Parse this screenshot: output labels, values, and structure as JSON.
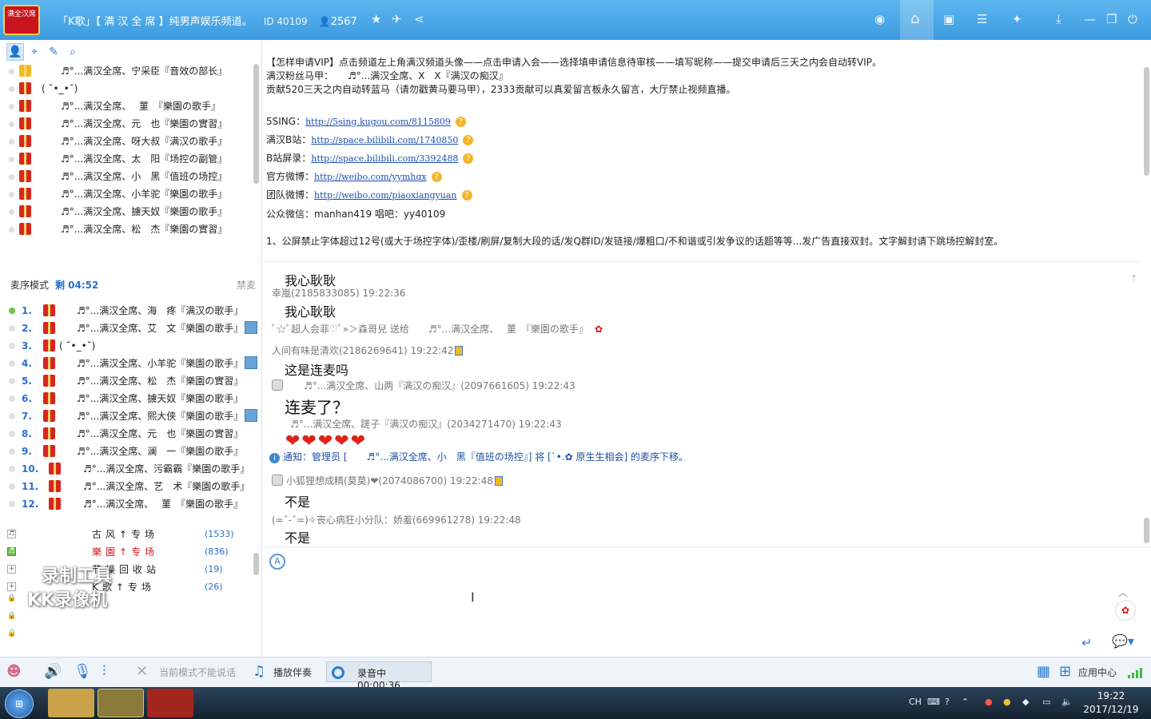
{
  "titlebar": {
    "logo_text": "满全汉席",
    "title": "「K歌」【 满 汉 全 席 】纯男声娱乐频道。",
    "id_label": "ID 40109",
    "online_count": "2567"
  },
  "members": [
    {
      "gift": "gold",
      "name": "♬°...满汉全席、宁采臣『音效の部长』"
    },
    {
      "gift": "red",
      "name": "( ˘•_•˘)",
      "short": true
    },
    {
      "gift": "red",
      "name": "♬°...满汉全席、　 菫　『樂園の歌手』"
    },
    {
      "gift": "red",
      "name": "♬°...满汉全席、元　也『樂園の實習』"
    },
    {
      "gift": "red",
      "name": "♬°...满汉全席、呀大叔『满汉の歌手』"
    },
    {
      "gift": "red",
      "name": "♬°...满汉全席、太　阳『场控の副管』"
    },
    {
      "gift": "red",
      "name": "♬°...满汉全席、小　黑『值班の场控』"
    },
    {
      "gift": "red",
      "name": "♬°...满汉全席、小羊驼『樂園の歌手』"
    },
    {
      "gift": "red",
      "name": "♬°...满汉全席、擄天奴『樂園の歌手』"
    },
    {
      "gift": "red",
      "name": "♬°...满汉全席、松　杰『樂園の實習』"
    }
  ],
  "queue": {
    "mode_label": "麦序模式",
    "remaining": "剩 04:52",
    "ban_label": "禁麦",
    "items": [
      {
        "num": "1.",
        "name": "♬°...满汉全席、海　疼『满汉の歌手』",
        "active": true
      },
      {
        "num": "2.",
        "name": "♬°...满汉全席、艾　文『樂園の歌手』",
        "avatar": true
      },
      {
        "num": "3.",
        "name": "( ˘•_•˘)",
        "short": true
      },
      {
        "num": "4.",
        "name": "♬°...满汉全席、小羊驼『樂園の歌手』",
        "avatar": true
      },
      {
        "num": "5.",
        "name": "♬°...满汉全席、松　杰『樂園の實習』"
      },
      {
        "num": "6.",
        "name": "♬°...满汉全席、擄天奴『樂園の歌手』"
      },
      {
        "num": "7.",
        "name": "♬°...满汉全席、熙大侠『樂園の歌手』",
        "avatar": true
      },
      {
        "num": "8.",
        "name": "♬°...满汉全席、元　也『樂園の實習』"
      },
      {
        "num": "9.",
        "name": "♬°...满汉全席、澜　一『樂園の歌手』"
      },
      {
        "num": "10.",
        "name": "♬°...满汉全席、污霸霸『樂園の歌手』",
        "wide": true
      },
      {
        "num": "11.",
        "name": "♬°...满汉全席、艺　术『樂園の歌手』",
        "wide": true
      },
      {
        "num": "12.",
        "name": "♬°...满汉全席、　 菫　『樂園の歌手』",
        "wide": true
      }
    ]
  },
  "rooms": [
    {
      "icon": "♬",
      "name": "古风↑专场",
      "count": "(1533)"
    },
    {
      "icon": "♬",
      "name": "樂園↑专场",
      "count": "(836)",
      "highlight": true
    },
    {
      "icon": "+",
      "name": "节操回收站",
      "count": "(19)"
    },
    {
      "icon": "+",
      "name": "K歌↑专场",
      "count": "(26)"
    }
  ],
  "watermark": {
    "line1": "录制工具",
    "line2": "KK录像机"
  },
  "announcement": {
    "line1": "【怎样申请VIP】点击频道左上角满汉频道头像——点击申请入会——选择填申请信息待审核——填写昵称——提交申请后三天之内会自动转VIP。",
    "line2": "满汉粉丝马甲：　　♬°...满汉全席、X　X『满汉の痴汉』",
    "line3": "贡献520三天之内自动转蓝马（请勿戳黄马要马甲），2333贡献可以真爱留言板永久留言，大厅禁止视频直播。",
    "links": [
      {
        "label": "5SING：",
        "url": "http://5sing.kugou.com/8115809"
      },
      {
        "label": "满汉B站：",
        "url": "http://space.bilibili.com/1740850"
      },
      {
        "label": "B站屏录：",
        "url": "http://space.bilibili.com/3392488"
      },
      {
        "label": "官方微博：",
        "url": "http://weibo.com/yymhqx"
      },
      {
        "label": "团队微博：",
        "url": "http://weibo.com/piaoxiangyuan"
      }
    ],
    "wechat": "公众微信：manhan419 唱吧：yy40109",
    "rules": "1、公屏禁止字体超过12号(或大于场控字体)/歪楼/刷屏/复制大段的话/发Q群ID/发链接/爆粗口/不和谐或引发争议的话题等等...发广告直接双封。文字解封请下跳场控解封室。"
  },
  "chat": {
    "m0_text": "我心耿耿",
    "m1_head": "幸嵐(2185833085) 19:22:36",
    "m1_text": "我心耿耿",
    "gift_line": "ﾟ☆ﾟ超人会菲♡ﾟ»＞森哥兒 送给　　♬°...满汉全席、　 菫　『樂園の歌手』",
    "m2_head": "人间有味是清欢(2186269641) 19:22:42",
    "m2_text": "这是连麦吗",
    "m3_head": "♬°...满汉全席、山两『满汉の痴汉』(2097661605) 19:22:43",
    "m3_text": "连麦了？",
    "m4_head": "♬°...满汉全席、蹉子『满汉の痴汉』(2034271470) 19:22:43",
    "hearts": "❤❤❤❤❤",
    "notice": "通知：管理员 [　　♬°...满汉全席、小　黑『值班の场控』] 将 [`•.✿ 原生生相会] 的麦序下移。",
    "m5_head": "小狐狸想成精(莫莫)❤(2074086700) 19:22:48",
    "m5_text": "不是",
    "m6_head": "(=ˇ-ˇ=)✧丧心病狂小分队：娇羞(669961278) 19:22:48",
    "m6_text": "不是"
  },
  "bottombar": {
    "mic_status": "当前模式不能说话",
    "accompany": "播放伴奏",
    "recording": "录音中 00:00:36",
    "app_center": "应用中心"
  },
  "taskbar": {
    "ime": "CH",
    "time": "19:22",
    "date": "2017/12/19"
  },
  "colors": {
    "titlebar": "#4aa8ea",
    "accent_blue": "#2b6fcf",
    "vip_red": "#d8141c"
  }
}
